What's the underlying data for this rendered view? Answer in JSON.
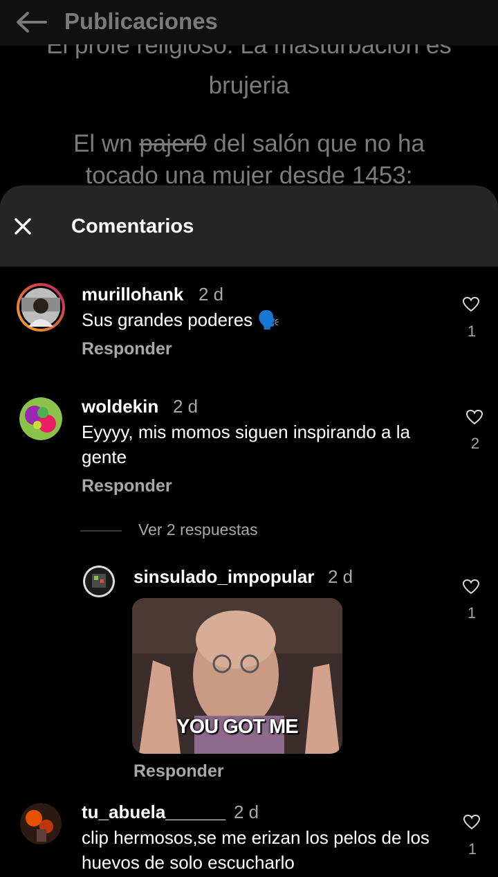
{
  "header": {
    "title": "Publicaciones"
  },
  "post": {
    "line1": "El profe religioso: La masturbación es",
    "line2": "brujeria",
    "line3_pre": "El wn ",
    "line3_strike": "pajer0",
    "line3_post": " del salón que no ha",
    "line4": "tocado una mujer desde 1453:"
  },
  "sheet": {
    "title": "Comentarios"
  },
  "comments": [
    {
      "username": "murillohank",
      "time": "2 d",
      "text": "Sus grandes poderes",
      "emoji": "🗣️",
      "reply_label": "Responder",
      "likes": "1"
    },
    {
      "username": "woldekin",
      "time": "2 d",
      "text": "Eyyyy, mis momos siguen inspirando a la gente",
      "reply_label": "Responder",
      "likes": "2"
    },
    {
      "username": "tu_abuela______",
      "time": "2 d",
      "text": "clip hermosos,se me erizan los pelos de los huevos de solo escucharlo",
      "likes": "1"
    }
  ],
  "view_replies": "Ver 2 respuestas",
  "reply_comment": {
    "username": "sinsulado_impopular",
    "time": "2 d",
    "gif_caption": "YOU GOT ME",
    "reply_label": "Responder",
    "likes": "1"
  },
  "colors": {
    "sheet_header": "#262626",
    "secondary_text": "#a8a8a8",
    "story_ring_start": "#f9a825",
    "story_ring_end": "#c2185b"
  }
}
